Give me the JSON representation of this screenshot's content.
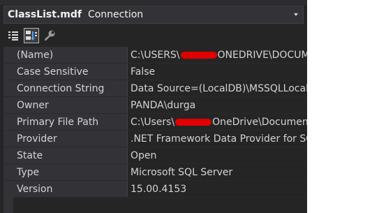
{
  "header": {
    "object_name": "ClassList.mdf",
    "object_type": "Connection"
  },
  "toolbar": {
    "buttons": [
      {
        "icon": "categorized-icon"
      },
      {
        "icon": "alphabetical-icon",
        "active": true
      },
      {
        "icon": "property-pages-wrench-icon"
      }
    ]
  },
  "properties": [
    {
      "name": "(Name)",
      "value_before": "C:\\USERS\\",
      "value_after": "ONEDRIVE\\DOCUM",
      "redacted": true
    },
    {
      "name": "Case Sensitive",
      "value": "False"
    },
    {
      "name": "Connection String",
      "value": "Data Source=(LocalDB)\\MSSQLLocalD"
    },
    {
      "name": "Owner",
      "value": "PANDA\\durga"
    },
    {
      "name": "Primary File Path",
      "value_before": "C:\\Users\\",
      "value_after": "OneDrive\\Documents\\",
      "redacted": true
    },
    {
      "name": "Provider",
      "value": ".NET Framework Data Provider for SQ"
    },
    {
      "name": "State",
      "value": "Open"
    },
    {
      "name": "Type",
      "value": "Microsoft SQL Server"
    },
    {
      "name": "Version",
      "value": "15.00.4153"
    }
  ],
  "colors": {
    "panel_bg": "#252526",
    "header_bg": "#333337",
    "text": "#d4d4d4",
    "redaction": "#e00000"
  }
}
